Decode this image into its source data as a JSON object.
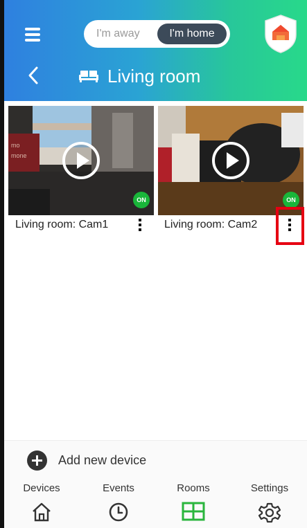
{
  "header": {
    "mode_toggle": {
      "away_label": "I'm away",
      "home_label": "I'm home",
      "selected": "I'm home"
    },
    "room_title": "Living room"
  },
  "cameras": [
    {
      "name": "Living room: Cam1",
      "status": "ON"
    },
    {
      "name": "Living room: Cam2",
      "status": "ON"
    }
  ],
  "add_device": {
    "label": "Add new device"
  },
  "bottom_nav": {
    "items": [
      {
        "label": "Devices",
        "icon": "home-icon"
      },
      {
        "label": "Events",
        "icon": "clock-icon"
      },
      {
        "label": "Rooms",
        "icon": "grid-icon",
        "active": true
      },
      {
        "label": "Settings",
        "icon": "gear-icon"
      }
    ]
  },
  "colors": {
    "accent_green": "#2ab53d",
    "badge_green": "#19b53a",
    "highlight_red": "#e60012",
    "toggle_dark": "#3c4a59"
  }
}
